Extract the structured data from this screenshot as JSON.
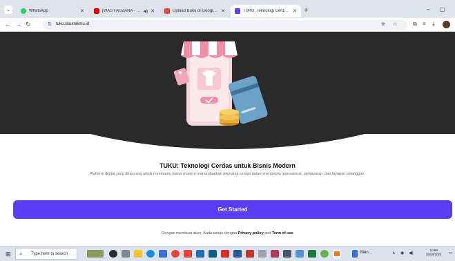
{
  "browser": {
    "tabs": [
      {
        "title": "WhatsApp",
        "favicon_color": "#25d366",
        "active": false
      },
      {
        "title": "[WAS FAUZANA - LAGU NI...",
        "favicon_color": "#e00000",
        "active": false
      },
      {
        "title": "Upload Buku di Google Play S...",
        "favicon_color": "#e8453c",
        "active": false
      },
      {
        "title": "TUKU: Teknologi Cerdas untuk...",
        "favicon_color": "#5b3df5",
        "active": true
      }
    ],
    "new_tab": "+",
    "window_min": "–",
    "window_max": "▢",
    "close_glyph": "✕",
    "address": "tuku.slaumikmu.id"
  },
  "page": {
    "title": "TUKU: Teknologi Cerdas untuk Bisnis Modern",
    "subtitle": "Platform digital yang dirancang untuk membantu bisnis modern memanfaatkan teknologi cerdas dalam mengelola operasional, pemasaran, dan layanan pelanggan.",
    "cta_label": "Get Started",
    "terms_prefix": "Dengan membuat akun, Anda setuju dengan ",
    "privacy_label": "Privacy policy",
    "terms_and": " and ",
    "terms_label": "Term of use",
    "accent_color": "#5b3df5"
  },
  "taskbar": {
    "search_placeholder": "Type here to search",
    "app_label": "Men...",
    "time": "10:59",
    "date": "25/09/2024"
  }
}
